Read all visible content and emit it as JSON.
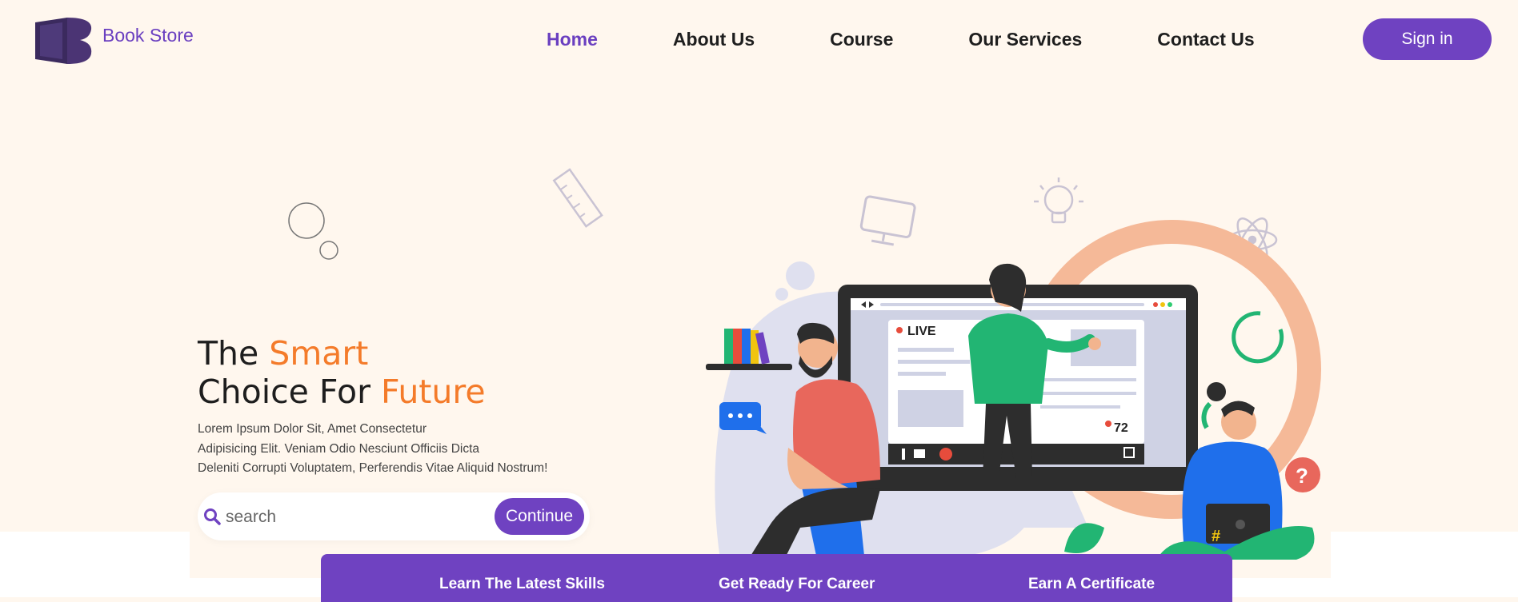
{
  "brand": {
    "name": "Book Store",
    "logo_icon": "book-logo-icon",
    "color": "#6a3fc0"
  },
  "nav": {
    "items": [
      {
        "label": "Home",
        "active": true
      },
      {
        "label": "About Us",
        "active": false
      },
      {
        "label": "Course",
        "active": false
      },
      {
        "label": "Our Services",
        "active": false
      },
      {
        "label": "Contact Us",
        "active": false
      }
    ],
    "signin_label": "Sign in"
  },
  "hero": {
    "line1_prefix": "The ",
    "line1_accent": "Smart",
    "line2_prefix": "Choice For ",
    "line2_accent": "Future",
    "description": [
      "Lorem Ipsum Dolor Sit, Amet Consectetur",
      "Adipisicing Elit. Veniam Odio Nesciunt Officiis Dicta",
      "Deleniti Corrupti Voluptatem, Perferendis Vitae Aliquid Nostrum!"
    ],
    "search": {
      "placeholder": "search",
      "value": "",
      "button_label": "Continue",
      "icon": "search-icon"
    }
  },
  "illustration": {
    "live_label": "LIVE",
    "viewer_count": "72"
  },
  "features": [
    "Learn The Latest Skills",
    "Get Ready For Career",
    "Earn A Certificate"
  ],
  "colors": {
    "accent_purple": "#6f42c1",
    "accent_orange": "#f47b2a",
    "background": "#fff7ee"
  }
}
